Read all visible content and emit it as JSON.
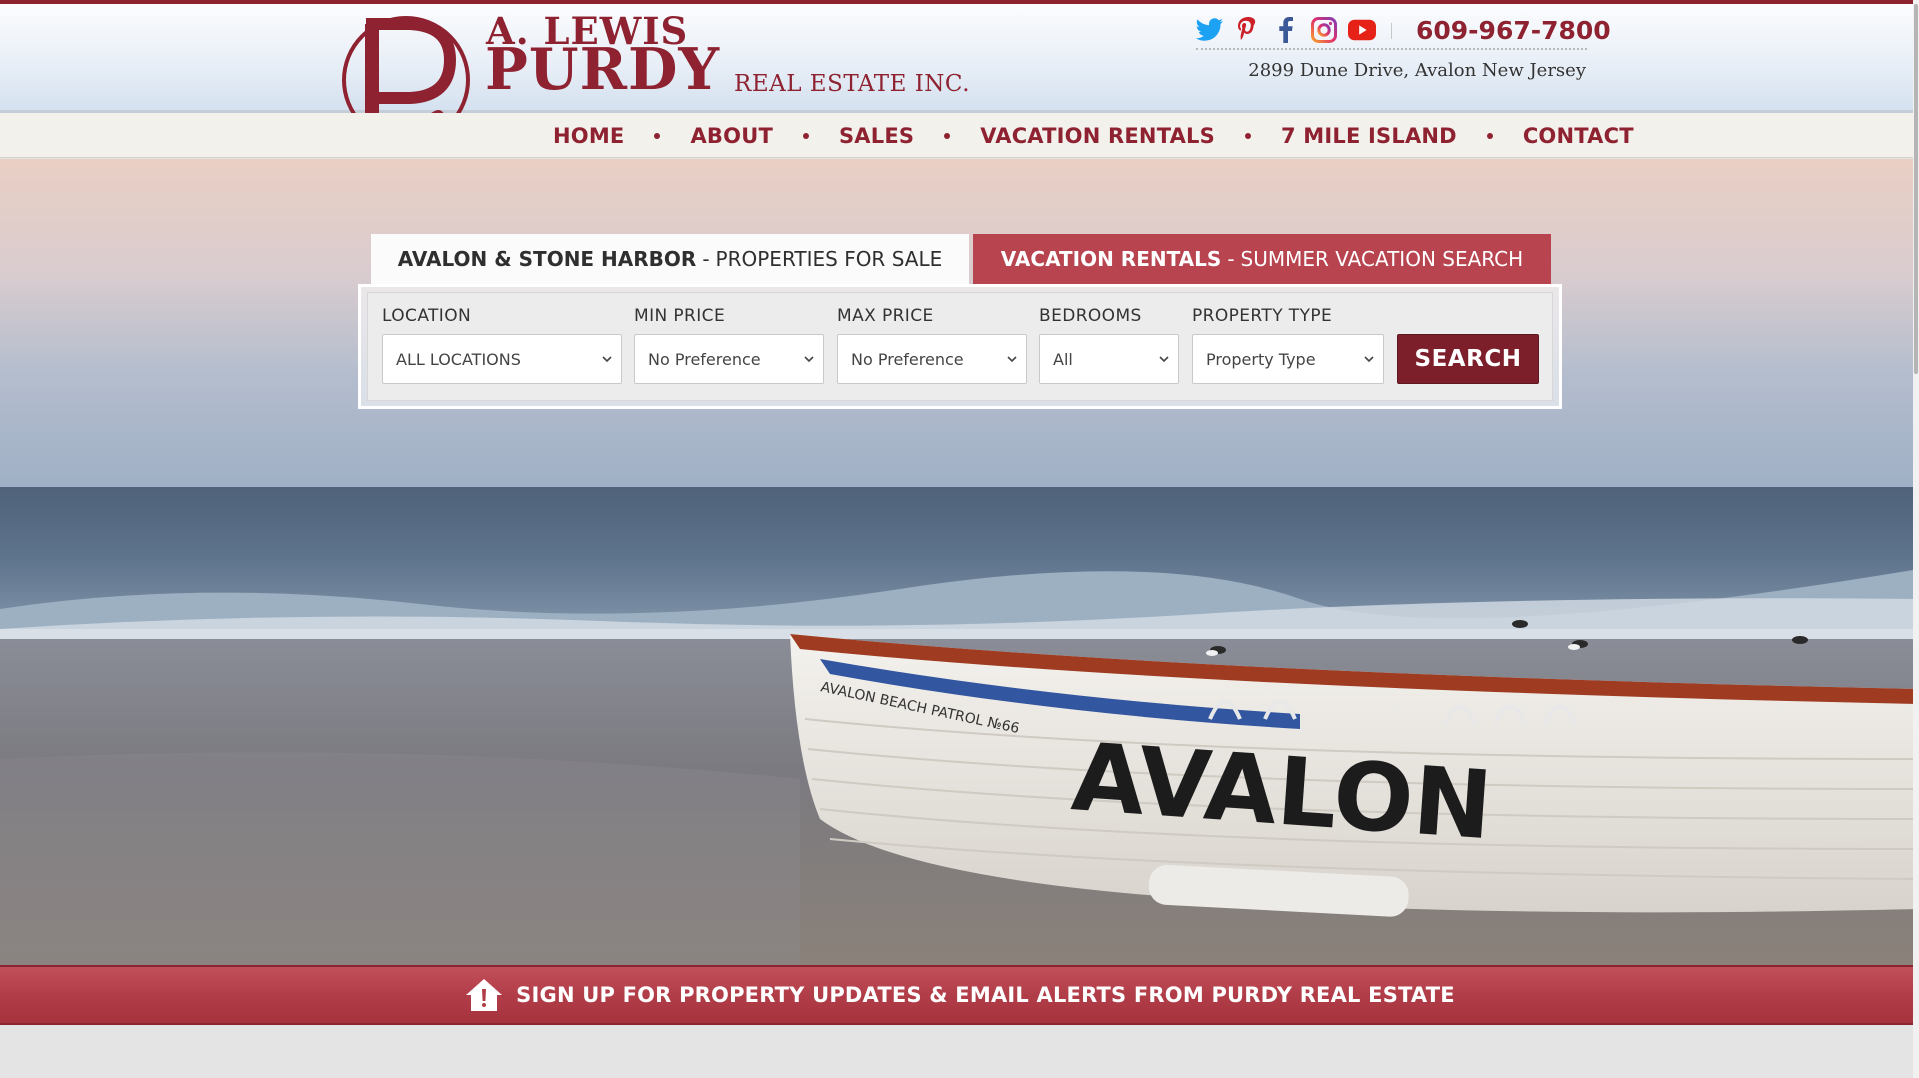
{
  "logo": {
    "name_line1": "A. LEWIS",
    "name_line2": "PURDY",
    "name_sub": "REAL ESTATE INC."
  },
  "contact": {
    "phone": "609-967-7800",
    "address": "2899 Dune Drive, Avalon New Jersey"
  },
  "social": [
    "twitter-icon",
    "pinterest-icon",
    "facebook-icon",
    "instagram-icon",
    "youtube-icon"
  ],
  "nav": {
    "items": [
      {
        "label": "HOME"
      },
      {
        "label": "ABOUT"
      },
      {
        "label": "SALES"
      },
      {
        "label": "VACATION RENTALS"
      },
      {
        "label": "7 MILE ISLAND"
      },
      {
        "label": "CONTACT"
      }
    ]
  },
  "tabs": {
    "sale": {
      "strong": "AVALON & STONE HARBOR",
      "sep": "-",
      "light": "PROPERTIES FOR SALE"
    },
    "rent": {
      "strong": "VACATION RENTALS",
      "sep": "-",
      "light": "SUMMER VACATION SEARCH"
    }
  },
  "search": {
    "location": {
      "label": "LOCATION",
      "value": "ALL LOCATIONS"
    },
    "min_price": {
      "label": "MIN PRICE",
      "value": "No Preference"
    },
    "max_price": {
      "label": "MAX PRICE",
      "value": "No Preference"
    },
    "bedrooms": {
      "label": "BEDROOMS",
      "value": "All"
    },
    "property_type": {
      "label": "PROPERTY TYPE",
      "value": "Property Type"
    },
    "button": "SEARCH"
  },
  "hero": {
    "boat_text": "AVALON",
    "boat_small": "AVALON BEACH PATROL №66"
  },
  "signup": {
    "text": "SIGN UP FOR PROPERTY UPDATES & EMAIL ALERTS FROM PURDY REAL ESTATE"
  },
  "colors": {
    "brand": "#8e2231",
    "tab_active": "#b84450",
    "button": "#7d1e2b"
  }
}
